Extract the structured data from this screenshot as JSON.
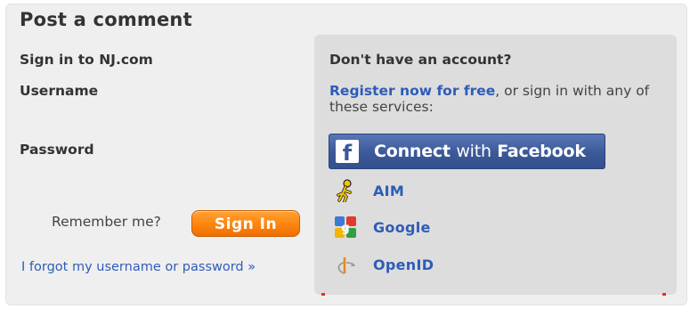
{
  "panel": {
    "title": "Post a comment"
  },
  "signin": {
    "heading": "Sign in to NJ.com",
    "username_label": "Username",
    "password_label": "Password",
    "remember_label": "Remember me?",
    "signin_button": "Sign In",
    "forgot_link": "I forgot my username or password »"
  },
  "register": {
    "heading": "Don't have an account?",
    "register_link": "Register now for free",
    "register_rest": ", or sign in with any of these services:",
    "facebook_button": {
      "bold": "Connect",
      "light": "with",
      "bold2": "Facebook"
    },
    "services": [
      {
        "name": "AIM",
        "icon": "aim-running-man-icon"
      },
      {
        "name": "Google",
        "icon": "google-icon"
      },
      {
        "name": "OpenID",
        "icon": "openid-icon"
      }
    ]
  },
  "colors": {
    "link": "#2e5cb8",
    "signin_orange": "#ff8a12",
    "facebook_blue": "#3b5998",
    "panel_bg": "#efefef",
    "right_panel_bg": "#dddddd"
  }
}
